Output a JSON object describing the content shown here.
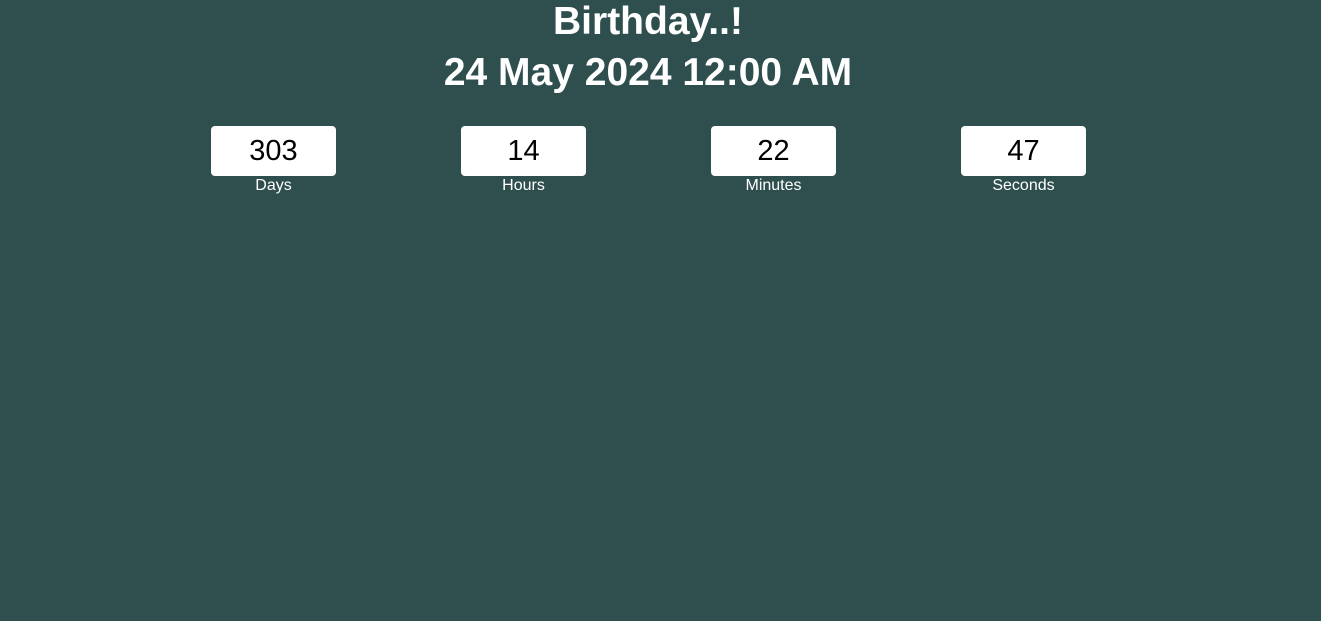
{
  "event": {
    "title": "Birthday..!",
    "date": "24 May 2024 12:00 AM"
  },
  "countdown": {
    "days": {
      "value": "303",
      "label": "Days"
    },
    "hours": {
      "value": "14",
      "label": "Hours"
    },
    "minutes": {
      "value": "22",
      "label": "Minutes"
    },
    "seconds": {
      "value": "47",
      "label": "Seconds"
    }
  },
  "colors": {
    "background": "#2f4f4f",
    "box": "#ffffff",
    "text": "#ffffff",
    "box_text": "#000000"
  }
}
